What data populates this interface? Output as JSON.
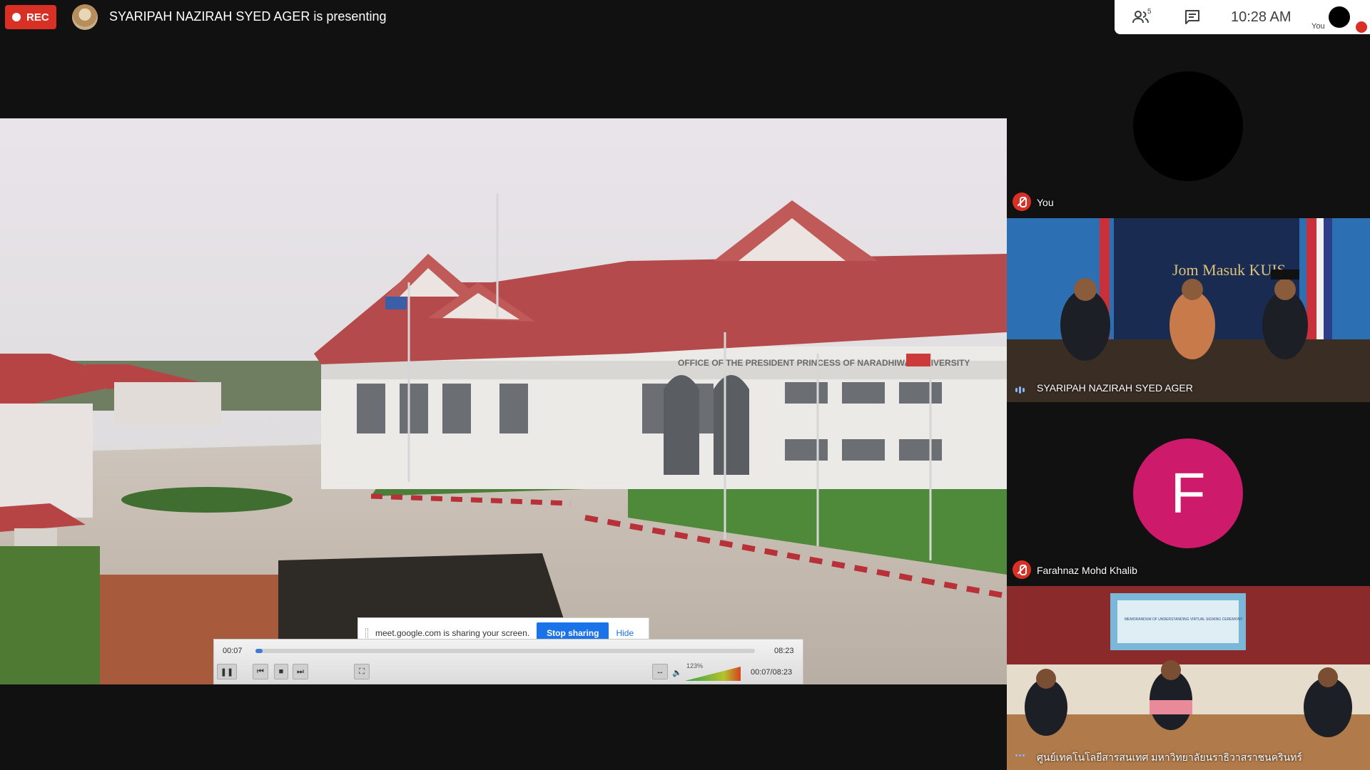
{
  "meeting": {
    "rec_label": "REC",
    "presenting_text": "SYARIPAH NAZIRAH SYED AGER is presenting",
    "participant_count": "5",
    "clock": "10:28  AM",
    "you_label": "You"
  },
  "screen_share": {
    "building_sign": "OFFICE OF THE PRESIDENT PRINCESS OF NARADHIWAS UNIVERSITY",
    "share_banner_text": "meet.google.com is sharing your screen.",
    "stop_sharing_label": "Stop sharing",
    "hide_label": "Hide",
    "player": {
      "elapsed": "00:07",
      "duration": "08:23",
      "position_text": "00:07/08:23",
      "volume": "123%",
      "progress_fraction": 0.014
    }
  },
  "tiles": [
    {
      "name": "You",
      "type": "avatar-blank",
      "muted": true
    },
    {
      "name": "SYARIPAH NAZIRAH SYED AGER",
      "type": "video",
      "speaking": true,
      "backdrop_text": "Jom Masuk KUIS"
    },
    {
      "name": "Farahnaz Mohd Khalib",
      "type": "avatar-letter",
      "letter": "F",
      "muted": true
    },
    {
      "name": "ศูนย์เทคโนโลยีสารสนเทศ มหาวิทยาลัยนราธิวาสราชนครินทร์",
      "type": "video",
      "speaking": true,
      "backdrop_text": "MEMORANDUM OF UNDERSTANDING VIRTUAL SIGNING CEREMONY"
    }
  ],
  "colors": {
    "rec": "#d93025",
    "stop_sharing": "#1a73e8",
    "avatar_f": "#cd1a6b",
    "background": "#111111"
  }
}
